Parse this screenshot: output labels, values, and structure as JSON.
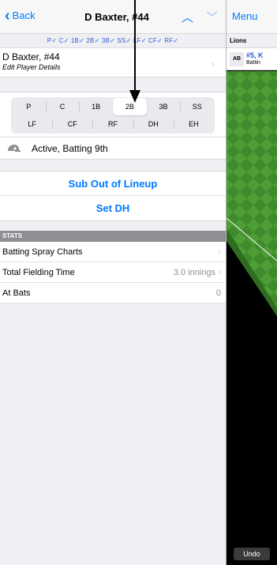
{
  "nav": {
    "back_label": "Back",
    "title": "D Baxter, #44",
    "up_icon": "chevron-up-icon",
    "down_icon": "chevron-down-icon"
  },
  "positions_strip": "P✓ C✓ 1B✓ 2B✓ 3B✓ SS✓ LF✓ CF✓ RF✓",
  "player": {
    "name": "D Baxter, #44",
    "subtitle": "Edit Player Details"
  },
  "position_picker": {
    "row1": [
      "P",
      "C",
      "1B",
      "2B",
      "3B",
      "SS"
    ],
    "row2": [
      "LF",
      "CF",
      "RF",
      "DH",
      "EH"
    ],
    "selected": "2B"
  },
  "status": {
    "icon": "batting-helmet-icon",
    "text": "Active, Batting 9th"
  },
  "actions": {
    "sub_out": "Sub Out of Lineup",
    "set_dh": "Set DH"
  },
  "stats": {
    "header": "STATS",
    "rows": [
      {
        "label": "Batting Spray Charts",
        "value": ""
      },
      {
        "label": "Total Fielding Time",
        "value": "3.0 innings"
      },
      {
        "label": "At Bats",
        "value": "0"
      }
    ]
  },
  "right": {
    "menu_label": "Menu",
    "team": "Lions",
    "ab_badge": "AB",
    "ab_num": "#5, K",
    "ab_sub": "Battin",
    "undo": "Undo"
  },
  "colors": {
    "accent": "#007aff",
    "field_dark": "#3f8a2c",
    "field_light": "#4e9d35"
  }
}
